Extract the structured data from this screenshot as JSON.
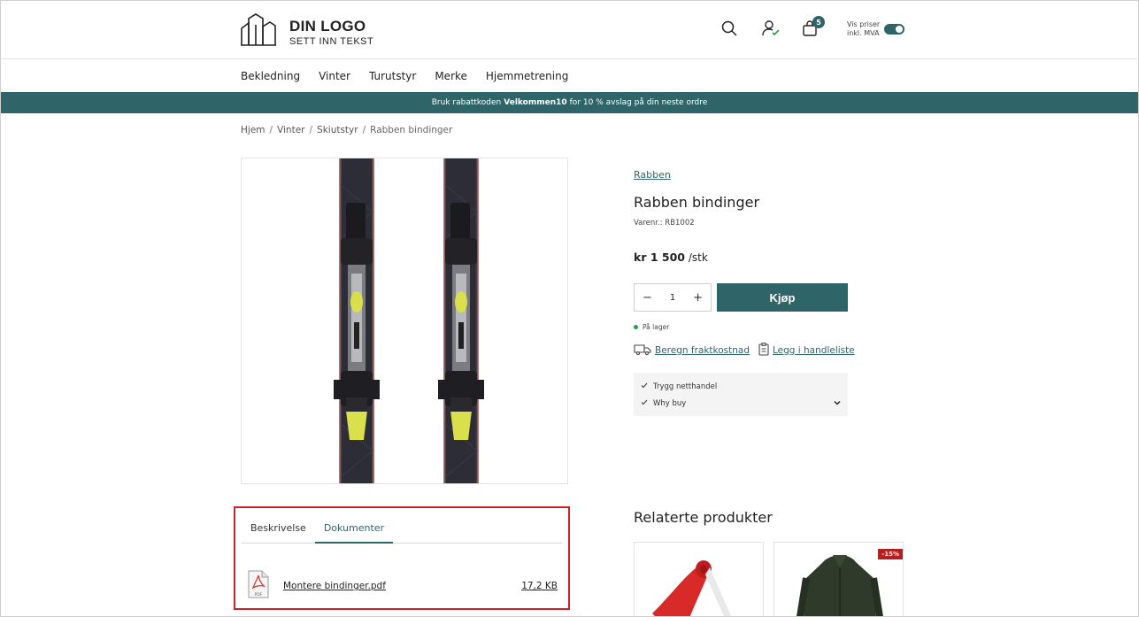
{
  "header": {
    "logo_title": "DIN LOGO",
    "logo_subtitle": "SETT INN TEKST",
    "cart_count": "5",
    "price_toggle_label_1": "Vis priser",
    "price_toggle_label_2": "inkl. MVA",
    "icons": [
      "search-icon",
      "user-icon",
      "cart-icon"
    ]
  },
  "nav": {
    "items": [
      "Bekledning",
      "Vinter",
      "Turutstyr",
      "Merke",
      "Hjemmetrening"
    ]
  },
  "banner": {
    "before": "Bruk rabattkoden",
    "code": "Velkommen10",
    "after": "for 10 % avslag på din neste ordre"
  },
  "breadcrumb": {
    "items": [
      "Hjem",
      "Vinter",
      "Skiutstyr"
    ],
    "current": "Rabben bindinger",
    "separator": "/"
  },
  "product": {
    "brand": "Rabben",
    "title": "Rabben bindinger",
    "sku": "Varenr.: RB1002",
    "price": "kr 1 500",
    "unit": "/stk",
    "quantity": "1",
    "buy_label": "Kjøp",
    "stock": "På lager",
    "freight_link": "Beregn fraktkostnad",
    "list_link": "Legg i handleliste",
    "usp": [
      "Trygg netthandel",
      "Why buy"
    ]
  },
  "tabs": {
    "items": [
      "Beskrivelse",
      "Dokumenter"
    ],
    "active": "Dokumenter",
    "document": {
      "name": "Montere bindinger.pdf",
      "size": "17,2 KB",
      "icon_label": "PDF"
    }
  },
  "related": {
    "title": "Relaterte produkter",
    "discount_badge": "-15%"
  },
  "colors": {
    "accent": "#2f6469",
    "highlight_border": "#c8232b",
    "discount": "#b2201f",
    "in_stock": "#22a045"
  }
}
